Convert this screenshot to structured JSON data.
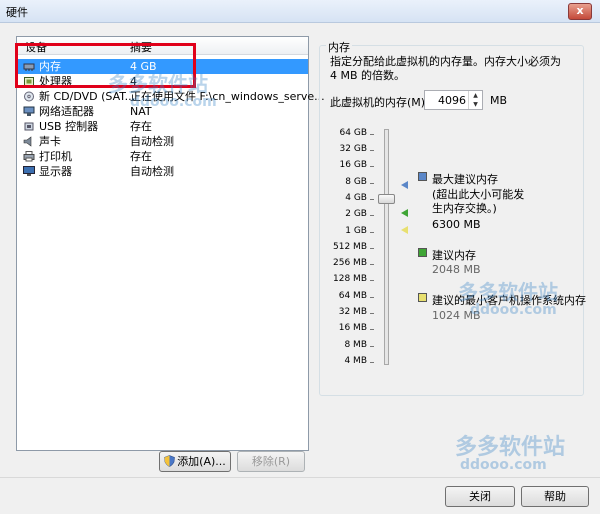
{
  "window": {
    "title": "硬件",
    "close_glyph": "x"
  },
  "device_list": {
    "columns": {
      "device": "设备",
      "summary": "摘要"
    },
    "rows": [
      {
        "name": "内存",
        "summary": "4 GB",
        "icon": "memory-icon",
        "selected": true
      },
      {
        "name": "处理器",
        "summary": "4",
        "icon": "cpu-icon",
        "selected": false
      },
      {
        "name": "新 CD/DVD (SAT...",
        "summary": "正在使用文件 F:\\cn_windows_serve...",
        "icon": "cd-dvd-icon",
        "selected": false
      },
      {
        "name": "网络适配器",
        "summary": "NAT",
        "icon": "network-adapter-icon",
        "selected": false
      },
      {
        "name": "USB 控制器",
        "summary": "存在",
        "icon": "usb-icon",
        "selected": false
      },
      {
        "name": "声卡",
        "summary": "自动检测",
        "icon": "sound-card-icon",
        "selected": false
      },
      {
        "name": "打印机",
        "summary": "存在",
        "icon": "printer-icon",
        "selected": false
      },
      {
        "name": "显示器",
        "summary": "自动检测",
        "icon": "display-icon",
        "selected": false
      }
    ]
  },
  "buttons": {
    "add": "添加(A)...",
    "remove": "移除(R)",
    "close": "关闭",
    "help": "帮助"
  },
  "memory": {
    "group_title": "内存",
    "description": "指定分配给此虚拟机的内存量。内存大小必须为 4 MB 的倍数。",
    "field_label": "此虚拟机的内存(M):",
    "value": "4096",
    "unit": "MB",
    "scale_labels": [
      "64 GB",
      "32 GB",
      "16 GB",
      "8 GB",
      "4 GB",
      "2 GB",
      "1 GB",
      "512 MB",
      "256 MB",
      "128 MB",
      "64 MB",
      "32 MB",
      "16 MB",
      "8 MB",
      "4 MB"
    ],
    "legend": {
      "max_label": "最大建议内存",
      "max_note": "(超出此大小可能发生内存交换。)",
      "max_value": "6300 MB",
      "rec_label": "建议内存",
      "rec_value": "2048 MB",
      "min_label": "建议的最小客户机操作系统内存",
      "min_value": "1024 MB"
    }
  },
  "watermark": {
    "brand": "多多软件站",
    "domain": "ddooo.com"
  },
  "colors": {
    "selection": "#3399ff",
    "highlight_box": "#e0001a",
    "max_marker": "#5b87c8",
    "rec_marker": "#3fa535",
    "min_marker": "#e8e070"
  }
}
